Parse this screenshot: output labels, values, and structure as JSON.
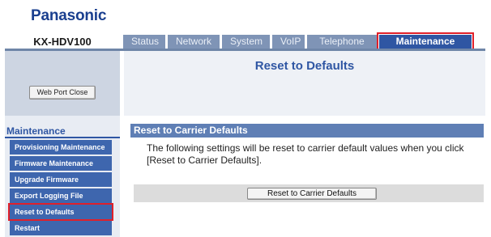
{
  "header": {
    "brand": "Panasonic",
    "model": "KX-HDV100",
    "tabs": [
      {
        "label": "Status"
      },
      {
        "label": "Network"
      },
      {
        "label": "System"
      },
      {
        "label": "VoIP"
      },
      {
        "label": "Telephone"
      },
      {
        "label": "Maintenance",
        "active": true
      }
    ]
  },
  "sidebar": {
    "web_port_close_label": "Web Port Close",
    "section_title": "Maintenance",
    "items": [
      {
        "label": "Provisioning Maintenance"
      },
      {
        "label": "Firmware Maintenance"
      },
      {
        "label": "Upgrade Firmware"
      },
      {
        "label": "Export Logging File"
      },
      {
        "label": "Reset to Defaults",
        "selected": true
      },
      {
        "label": "Restart"
      }
    ]
  },
  "main": {
    "page_title": "Reset to Defaults",
    "section_title": "Reset to Carrier Defaults",
    "description": "The following settings will be reset to carrier default values when you click [Reset to Carrier Defaults].",
    "button_label": "Reset to Carrier Defaults"
  },
  "colors": {
    "brand": "#1a3f8f",
    "tab": "#7f94b6",
    "tab_active": "#2f56a3",
    "highlight": "#e0202a",
    "sidebar_item": "#3e66ae",
    "section_bar": "#5f7fb5"
  }
}
